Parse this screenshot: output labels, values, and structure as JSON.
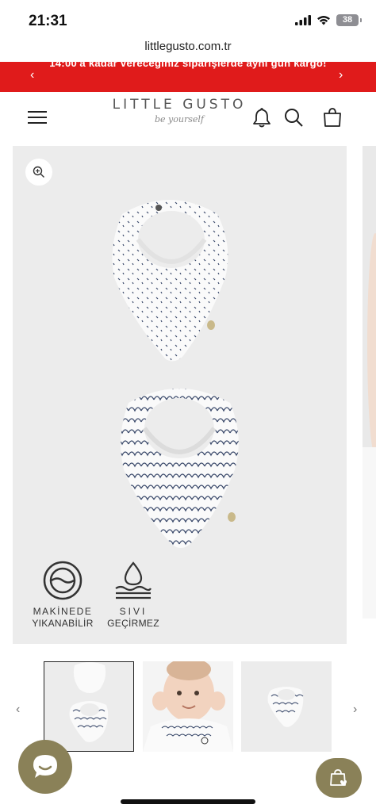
{
  "status_bar": {
    "time": "21:31",
    "battery": "38"
  },
  "browser": {
    "url": "littlegusto.com.tr"
  },
  "announcement": {
    "text": "14:00'a kadar vereceğiniz siparişlerde aynı gün kargo!",
    "background": "#e01b1b",
    "prev_icon": "chevron-left-icon",
    "next_icon": "chevron-right-icon"
  },
  "header": {
    "logo_text": "LITTLE GUSTO",
    "logo_tagline": "be yourself",
    "menu_icon": "hamburger-icon",
    "bell_icon": "bell-icon",
    "search_icon": "search-icon",
    "cart_icon": "bag-icon"
  },
  "gallery": {
    "zoom_icon": "zoom-in-icon",
    "badges": [
      {
        "icon": "washing-machine-icon",
        "line1": "MAKİNEDE",
        "line2": "YIKANABİLİR"
      },
      {
        "icon": "water-drop-icon",
        "line1": "SIVI",
        "line2": "GEÇİRMEZ"
      }
    ]
  },
  "thumbnails": {
    "count": 3,
    "active_index": 0,
    "prev_icon": "chevron-left-icon",
    "next_icon": "chevron-right-icon"
  },
  "floating": {
    "chat_icon": "chat-bubble-icon",
    "bag_icon": "shopping-bag-heart-icon",
    "accent": "#8a8158"
  }
}
